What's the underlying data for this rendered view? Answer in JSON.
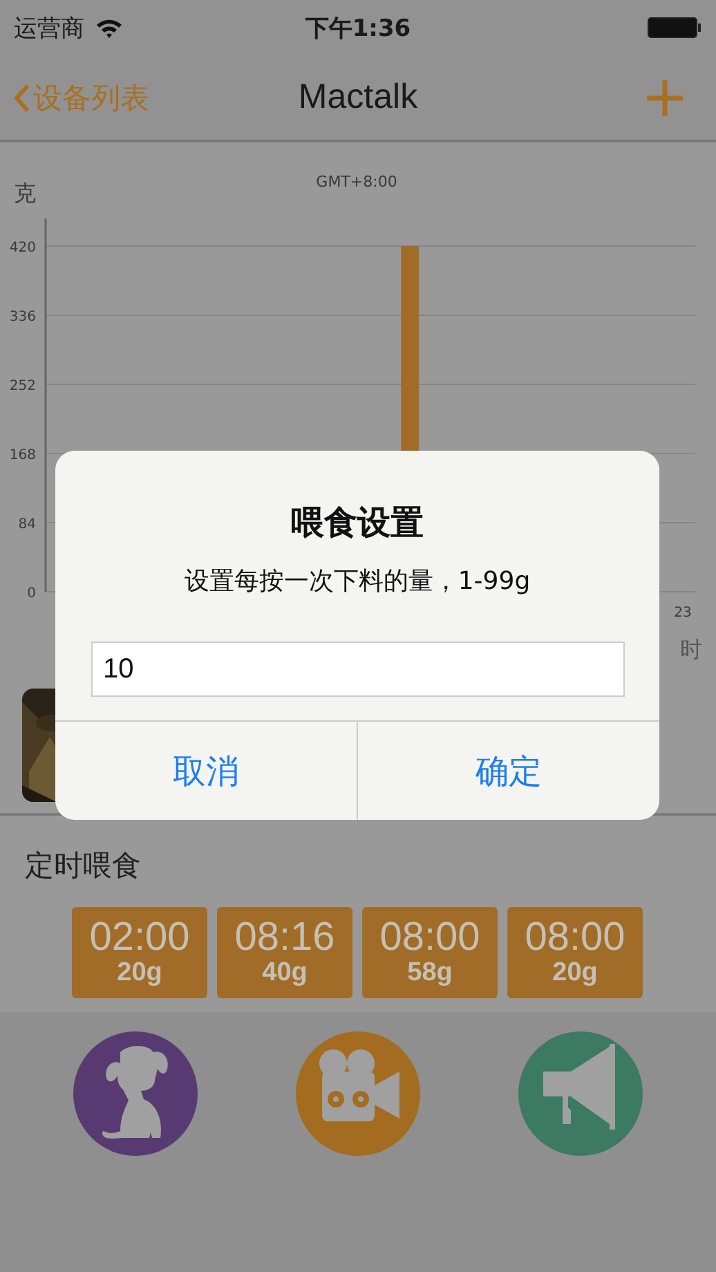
{
  "status_bar": {
    "carrier": "运营商",
    "time": "下午1:36"
  },
  "nav_bar": {
    "back": "设备列表",
    "title": "Mactalk"
  },
  "chart": {
    "chart_data": {
      "type": "bar",
      "title": "GMT+8:00",
      "ylabel": "克",
      "xlabel": "时",
      "grid": true,
      "values": [
        0,
        0,
        0,
        0,
        0,
        0,
        0,
        0,
        0,
        0,
        0,
        0,
        0,
        420,
        0,
        0,
        0,
        0,
        0,
        0,
        0,
        0,
        0,
        0
      ],
      "ylim": [
        0,
        420
      ],
      "yticks": [
        {
          "value": 0,
          "label": "0"
        },
        {
          "value": 84,
          "label": "84"
        },
        {
          "value": 168,
          "label": "168"
        },
        {
          "value": 252,
          "label": "252"
        },
        {
          "value": 336,
          "label": "336"
        },
        {
          "value": 420,
          "label": "420"
        }
      ]
    },
    "x_end_label": "23"
  },
  "schedule": {
    "title": "定时喂食",
    "slots": [
      {
        "time": "02:00",
        "amount": "20g"
      },
      {
        "time": "08:16",
        "amount": "40g"
      },
      {
        "time": "08:00",
        "amount": "58g"
      },
      {
        "time": "08:00",
        "amount": "20g"
      }
    ]
  },
  "actions": [
    {
      "kind": "pet",
      "color": "#583a72"
    },
    {
      "kind": "video",
      "color": "#a36c20"
    },
    {
      "kind": "speaker",
      "color": "#3d7a62"
    }
  ],
  "dialog": {
    "title": "喂食设置",
    "message": "设置每按一次下料的量，1-99g",
    "input": {
      "value": "10"
    },
    "buttons": [
      "取消",
      "确定"
    ]
  }
}
